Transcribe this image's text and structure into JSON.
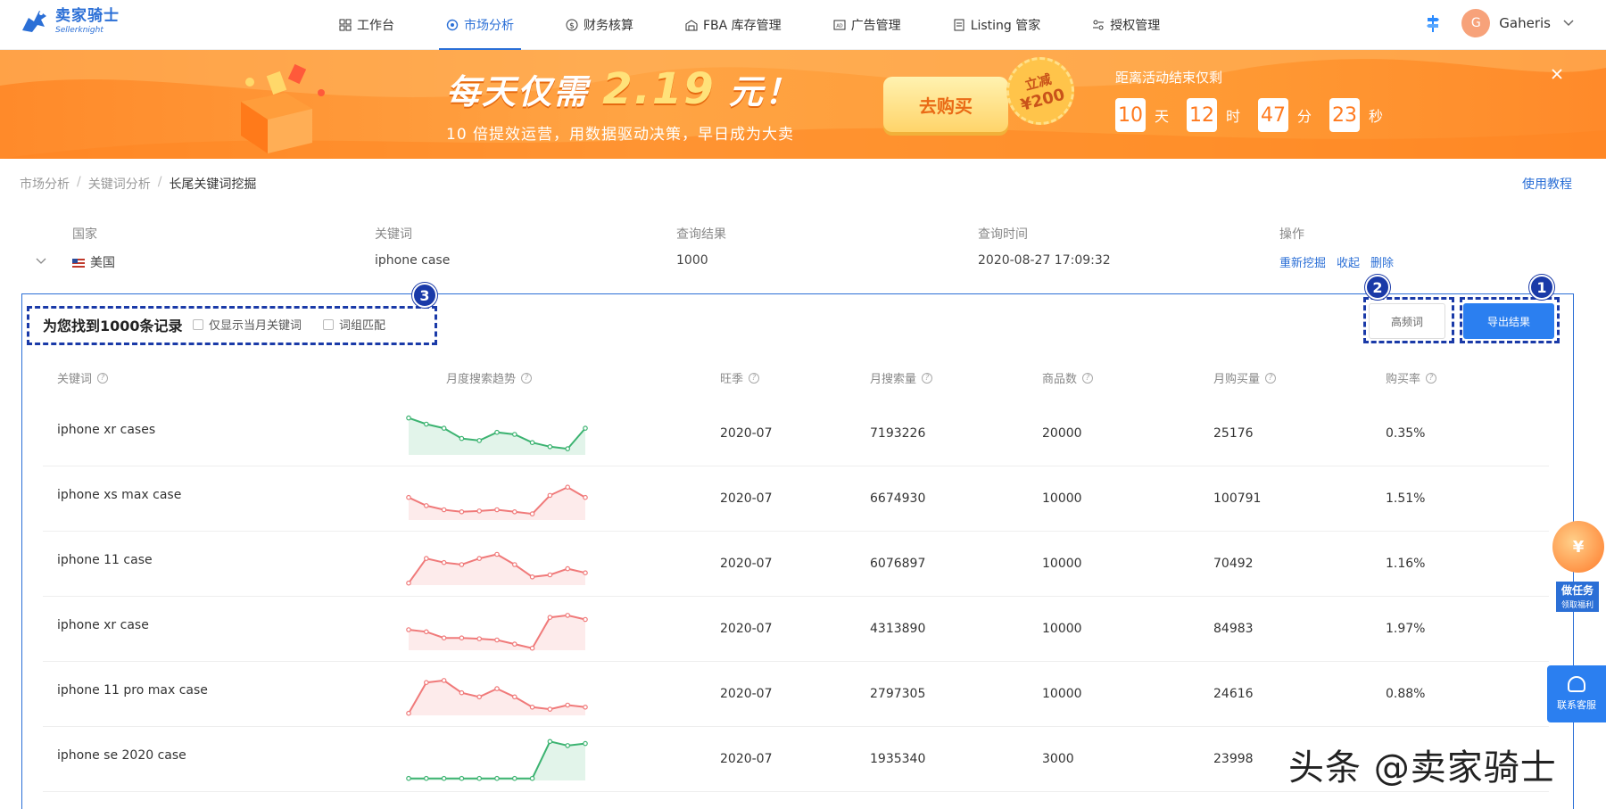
{
  "header": {
    "logo_cn": "卖家骑士",
    "logo_en": "Sellerknight",
    "nav": [
      {
        "label": "工作台",
        "icon": "grid-icon",
        "active": false
      },
      {
        "label": "市场分析",
        "icon": "target-icon",
        "active": true
      },
      {
        "label": "财务核算",
        "icon": "dollar-icon",
        "active": false
      },
      {
        "label": "FBA 库存管理",
        "icon": "warehouse-icon",
        "active": false
      },
      {
        "label": "广告管理",
        "icon": "ad-icon",
        "active": false
      },
      {
        "label": "Listing 管家",
        "icon": "document-icon",
        "active": false
      },
      {
        "label": "授权管理",
        "icon": "authorize-icon",
        "active": false
      }
    ],
    "user_initial": "G",
    "user_name": "Gaheris"
  },
  "banner": {
    "title_prefix": "每天仅需",
    "title_price": "2.19",
    "title_suffix": "元！",
    "subtitle": "10 倍提效运营，用数据驱动决策，早日成为大卖",
    "buy_label": "去购买",
    "discount_line1": "立减",
    "discount_line2": "¥200",
    "countdown_title": "距离活动结束仅剩",
    "countdown": {
      "days": "10",
      "days_unit": "天",
      "hours": "12",
      "hours_unit": "时",
      "minutes": "47",
      "minutes_unit": "分",
      "seconds": "23",
      "seconds_unit": "秒"
    }
  },
  "breadcrumb": {
    "items": [
      "市场分析",
      "关键词分析",
      "长尾关键词挖掘"
    ],
    "tutorial": "使用教程"
  },
  "query": {
    "headers": [
      "国家",
      "关键词",
      "查询结果",
      "查询时间",
      "操作"
    ],
    "country": "美国",
    "keyword": "iphone case",
    "result": "1000",
    "time": "2020-08-27 17:09:32",
    "actions": [
      "重新挖掘",
      "收起",
      "删除"
    ]
  },
  "results": {
    "found_text": "为您找到1000条记录",
    "filter_current_month": "仅显示当月关键词",
    "filter_phrase_match": "词组匹配",
    "high_freq_button": "高频词",
    "export_button": "导出结果",
    "markers": [
      "1",
      "2",
      "3"
    ],
    "columns": [
      "关键词",
      "月度搜索趋势",
      "旺季",
      "月搜索量",
      "商品数",
      "月购买量",
      "购买率"
    ],
    "rows": [
      {
        "keyword": "iphone xr cases",
        "season": "2020-07",
        "searches": "7193226",
        "products": "20000",
        "purchases": "25176",
        "rate": "0.35%",
        "trend_color": "#3cb371",
        "trend": [
          0.9,
          0.75,
          0.65,
          0.4,
          0.35,
          0.55,
          0.5,
          0.3,
          0.2,
          0.15,
          0.65
        ]
      },
      {
        "keyword": "iphone xs max case",
        "season": "2020-07",
        "searches": "6674930",
        "products": "10000",
        "purchases": "100791",
        "rate": "1.51%",
        "trend_color": "#f07a7a",
        "trend": [
          0.55,
          0.35,
          0.25,
          0.2,
          0.22,
          0.25,
          0.2,
          0.15,
          0.6,
          0.8,
          0.55
        ]
      },
      {
        "keyword": "iphone 11 case",
        "season": "2020-07",
        "searches": "6076897",
        "products": "10000",
        "purchases": "70492",
        "rate": "1.16%",
        "trend_color": "#f07a7a",
        "trend": [
          0.05,
          0.65,
          0.55,
          0.5,
          0.65,
          0.75,
          0.5,
          0.2,
          0.25,
          0.4,
          0.3
        ]
      },
      {
        "keyword": "iphone xr case",
        "season": "2020-07",
        "searches": "4313890",
        "products": "10000",
        "purchases": "84983",
        "rate": "1.97%",
        "trend_color": "#f07a7a",
        "trend": [
          0.5,
          0.45,
          0.3,
          0.3,
          0.28,
          0.25,
          0.15,
          0.05,
          0.8,
          0.85,
          0.75
        ]
      },
      {
        "keyword": "iphone 11 pro max case",
        "season": "2020-07",
        "searches": "2797305",
        "products": "10000",
        "purchases": "24616",
        "rate": "0.88%",
        "trend_color": "#f07a7a",
        "trend": [
          0.05,
          0.8,
          0.85,
          0.55,
          0.45,
          0.65,
          0.45,
          0.2,
          0.15,
          0.25,
          0.2
        ]
      },
      {
        "keyword": "iphone se 2020 case",
        "season": "2020-07",
        "searches": "1935340",
        "products": "3000",
        "purchases": "23998",
        "rate": "",
        "trend_color": "#3cb371",
        "trend": [
          0.05,
          0.05,
          0.05,
          0.05,
          0.05,
          0.05,
          0.05,
          0.05,
          0.95,
          0.85,
          0.9
        ]
      }
    ]
  },
  "float": {
    "task_label": "做任务",
    "task_sub": "领取福利",
    "coin": "¥",
    "service_label": "联系客服"
  },
  "watermark": "头条 @卖家骑士"
}
